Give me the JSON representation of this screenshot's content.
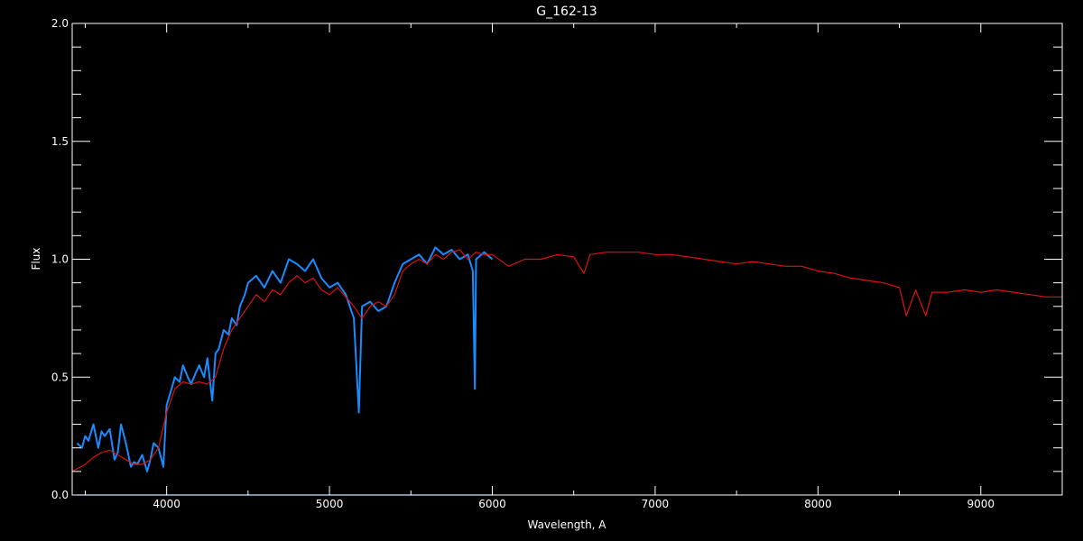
{
  "chart_data": {
    "type": "line",
    "title": "G_162-13",
    "xlabel": "Wavelength, A",
    "ylabel": "Flux",
    "xlim": [
      3420,
      9500
    ],
    "ylim": [
      0.0,
      2.0
    ],
    "xticks": [
      4000,
      5000,
      6000,
      7000,
      8000,
      9000
    ],
    "xtick_labels": [
      "4000",
      "5000",
      "6000",
      "7000",
      "8000",
      "9000"
    ],
    "yticks": [
      0.0,
      0.5,
      1.0,
      1.5,
      2.0
    ],
    "ytick_labels": [
      "0.0",
      "0.5",
      "1.0",
      "1.5",
      "2.0"
    ],
    "grid": false,
    "background": "#000000",
    "frame_color": "#ffffff",
    "series": [
      {
        "style": "line",
        "color": "#1a8cff",
        "x": [
          3450,
          3480,
          3500,
          3520,
          3550,
          3580,
          3600,
          3620,
          3650,
          3680,
          3700,
          3720,
          3750,
          3780,
          3800,
          3820,
          3850,
          3880,
          3900,
          3920,
          3950,
          3980,
          4000,
          4030,
          4050,
          4080,
          4100,
          4130,
          4150,
          4180,
          4200,
          4230,
          4250,
          4280,
          4300,
          4320,
          4350,
          4380,
          4400,
          4430,
          4450,
          4480,
          4500,
          4550,
          4600,
          4650,
          4700,
          4750,
          4800,
          4850,
          4900,
          4950,
          5000,
          5050,
          5100,
          5150,
          5180,
          5200,
          5250,
          5300,
          5350,
          5400,
          5450,
          5500,
          5550,
          5600,
          5650,
          5700,
          5750,
          5800,
          5850,
          5880,
          5893,
          5900,
          5950,
          6000
        ],
        "y": [
          0.22,
          0.2,
          0.25,
          0.23,
          0.3,
          0.2,
          0.27,
          0.25,
          0.28,
          0.15,
          0.18,
          0.3,
          0.22,
          0.12,
          0.14,
          0.13,
          0.17,
          0.1,
          0.15,
          0.22,
          0.2,
          0.12,
          0.38,
          0.45,
          0.5,
          0.48,
          0.55,
          0.5,
          0.47,
          0.52,
          0.55,
          0.5,
          0.58,
          0.4,
          0.6,
          0.62,
          0.7,
          0.68,
          0.75,
          0.72,
          0.8,
          0.85,
          0.9,
          0.93,
          0.88,
          0.95,
          0.9,
          1.0,
          0.98,
          0.95,
          1.0,
          0.92,
          0.88,
          0.9,
          0.85,
          0.75,
          0.35,
          0.8,
          0.82,
          0.78,
          0.8,
          0.9,
          0.98,
          1.0,
          1.02,
          0.98,
          1.05,
          1.02,
          1.04,
          1.0,
          1.02,
          0.95,
          0.45,
          1.0,
          1.03,
          1.0
        ]
      },
      {
        "style": "line",
        "color": "#dd1111",
        "x": [
          3420,
          3500,
          3550,
          3600,
          3650,
          3700,
          3750,
          3800,
          3850,
          3900,
          3950,
          4000,
          4050,
          4100,
          4150,
          4200,
          4250,
          4300,
          4350,
          4400,
          4450,
          4500,
          4550,
          4600,
          4650,
          4700,
          4750,
          4800,
          4850,
          4900,
          4950,
          5000,
          5050,
          5100,
          5150,
          5200,
          5250,
          5300,
          5350,
          5400,
          5450,
          5500,
          5550,
          5600,
          5650,
          5700,
          5750,
          5800,
          5850,
          5900,
          5950,
          6000,
          6100,
          6200,
          6300,
          6400,
          6500,
          6563,
          6600,
          6700,
          6800,
          6900,
          7000,
          7100,
          7200,
          7300,
          7400,
          7500,
          7600,
          7700,
          7800,
          7900,
          8000,
          8100,
          8200,
          8300,
          8400,
          8500,
          8542,
          8600,
          8662,
          8700,
          8800,
          8900,
          9000,
          9100,
          9200,
          9300,
          9400,
          9500
        ],
        "y": [
          0.1,
          0.13,
          0.16,
          0.18,
          0.19,
          0.17,
          0.15,
          0.13,
          0.13,
          0.15,
          0.2,
          0.35,
          0.45,
          0.48,
          0.47,
          0.48,
          0.47,
          0.5,
          0.62,
          0.7,
          0.75,
          0.8,
          0.85,
          0.82,
          0.87,
          0.85,
          0.9,
          0.93,
          0.9,
          0.92,
          0.87,
          0.85,
          0.88,
          0.84,
          0.8,
          0.75,
          0.8,
          0.82,
          0.8,
          0.85,
          0.95,
          0.98,
          1.0,
          0.98,
          1.02,
          1.0,
          1.03,
          1.04,
          1.0,
          1.03,
          1.02,
          1.02,
          0.97,
          1.0,
          1.0,
          1.02,
          1.01,
          0.94,
          1.02,
          1.03,
          1.03,
          1.03,
          1.02,
          1.02,
          1.01,
          1.0,
          0.99,
          0.98,
          0.99,
          0.98,
          0.97,
          0.97,
          0.95,
          0.94,
          0.92,
          0.91,
          0.9,
          0.88,
          0.76,
          0.87,
          0.76,
          0.86,
          0.86,
          0.87,
          0.86,
          0.87,
          0.86,
          0.85,
          0.84,
          0.84
        ]
      },
      {
        "style": "line",
        "color": "#1a8cff",
        "x": [
          3450,
          6000
        ],
        "y": [
          0.0,
          0.0
        ]
      }
    ]
  }
}
